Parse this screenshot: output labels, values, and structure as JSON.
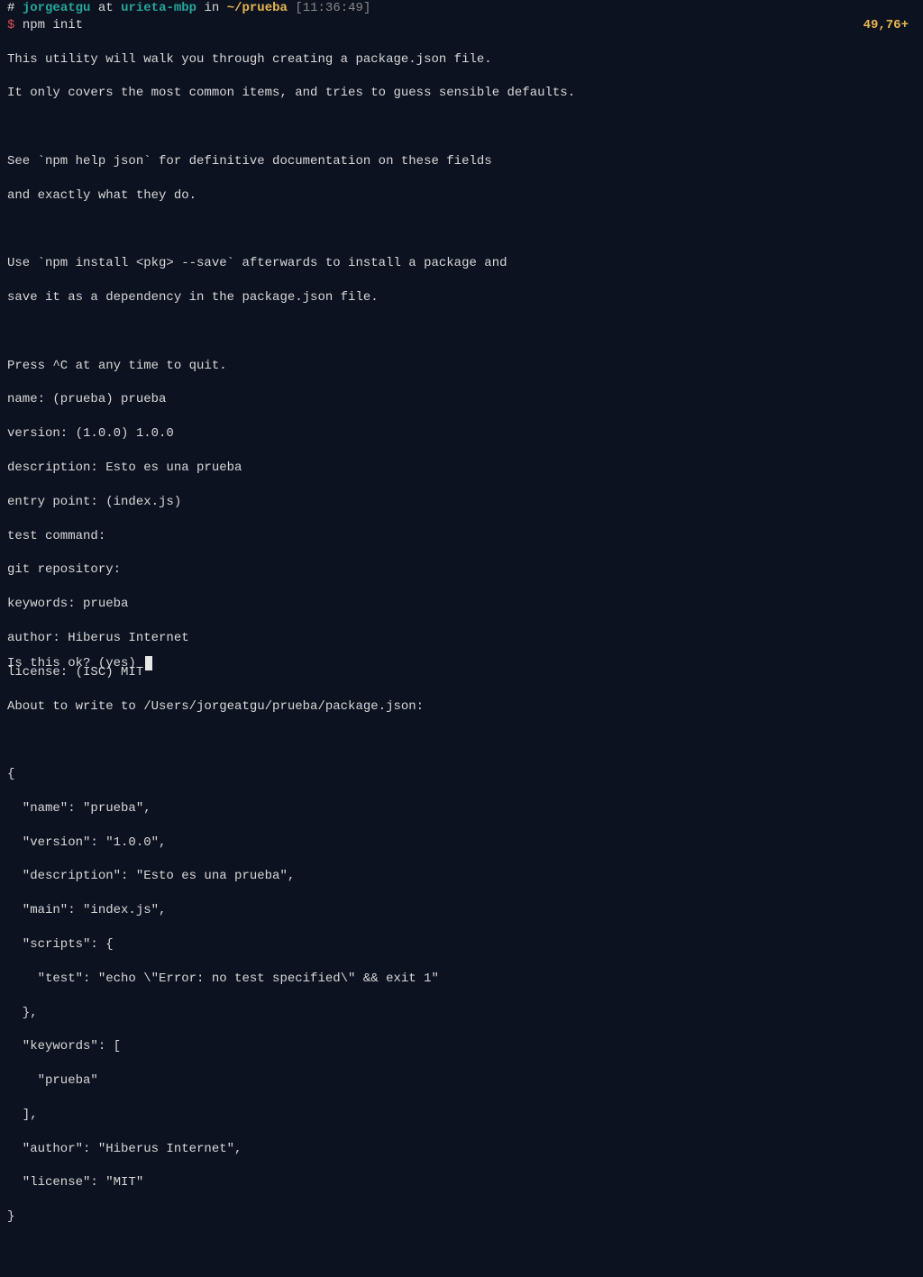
{
  "prompt": {
    "hash": "#",
    "user": "jorgeatgu",
    "at": "at",
    "host": "urieta-mbp",
    "in": "in",
    "path": "~/prueba",
    "timestamp": "[11:36:49]"
  },
  "command": {
    "dollar": "$",
    "text": "npm init"
  },
  "position": "49,76+",
  "lines": {
    "l1": "This utility will walk you through creating a package.json file.",
    "l2": "It only covers the most common items, and tries to guess sensible defaults.",
    "l3": "",
    "l4": "See `npm help json` for definitive documentation on these fields",
    "l5": "and exactly what they do.",
    "l6": "",
    "l7": "Use `npm install <pkg> --save` afterwards to install a package and",
    "l8": "save it as a dependency in the package.json file.",
    "l9": "",
    "l10": "Press ^C at any time to quit.",
    "l11": "name: (prueba) prueba",
    "l12": "version: (1.0.0) 1.0.0",
    "l13": "description: Esto es una prueba",
    "l14": "entry point: (index.js)",
    "l15": "test command:",
    "l16": "git repository:",
    "l17": "keywords: prueba",
    "l18": "author: Hiberus Internet",
    "l19": "license: (ISC) MIT",
    "l20": "About to write to /Users/jorgeatgu/prueba/package.json:",
    "l21": "",
    "l22": "{",
    "l23": "  \"name\": \"prueba\",",
    "l24": "  \"version\": \"1.0.0\",",
    "l25": "  \"description\": \"Esto es una prueba\",",
    "l26": "  \"main\": \"index.js\",",
    "l27": "  \"scripts\": {",
    "l28": "    \"test\": \"echo \\\"Error: no test specified\\\" && exit 1\"",
    "l29": "  },",
    "l30": "  \"keywords\": [",
    "l31": "    \"prueba\"",
    "l32": "  ],",
    "l33": "  \"author\": \"Hiberus Internet\",",
    "l34": "  \"license\": \"MIT\"",
    "l35": "}",
    "l36": ""
  },
  "final": "Is this ok? (yes) "
}
